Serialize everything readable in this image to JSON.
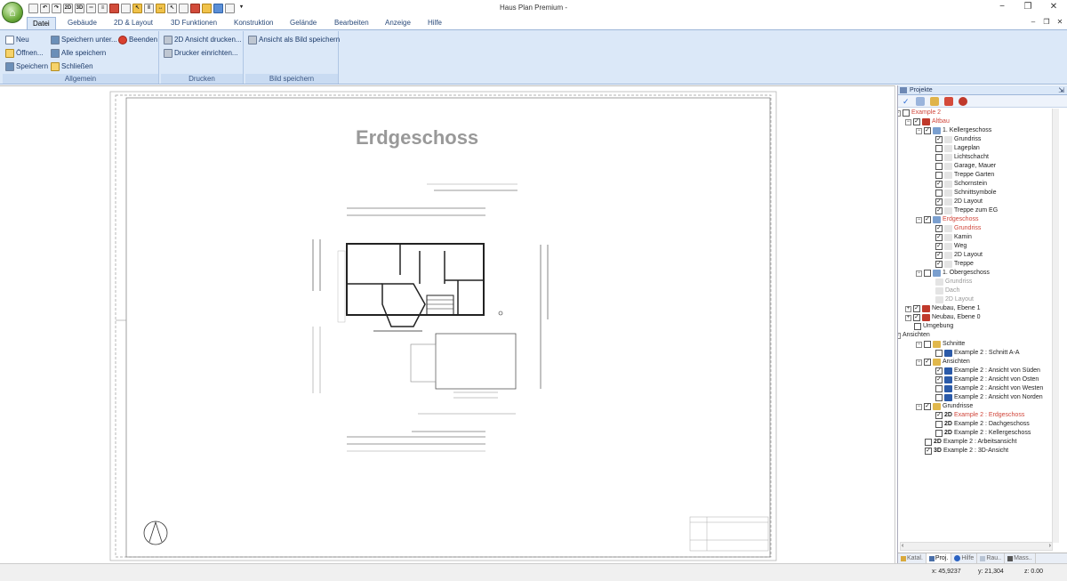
{
  "window": {
    "title": "Haus Plan Premium -",
    "min": "−",
    "max": "❐",
    "close": "✕"
  },
  "ribbon_tabs": [
    "Datei",
    "Gebäude",
    "2D & Layout",
    "3D Funktionen",
    "Konstruktion",
    "Gelände",
    "Bearbeiten",
    "Anzeige",
    "Hilfe"
  ],
  "groups": {
    "allgemein": {
      "label": "Allgemein",
      "neu": "Neu",
      "oeffnen": "Öffnen...",
      "speichern": "Speichern",
      "speichern_unter": "Speichern unter...",
      "alle_speichern": "Alle speichern",
      "schliessen": "Schließen",
      "beenden": "Beenden"
    },
    "drucken": {
      "label": "Drucken",
      "ansicht_drucken": "2D Ansicht drucken...",
      "drucker": "Drucker einrichten..."
    },
    "bild": {
      "label": "Bild speichern",
      "ansicht_bild": "Ansicht als Bild speichern"
    }
  },
  "drawing": {
    "title": "Erdgeschoss"
  },
  "panel": {
    "title": "Projekte",
    "tree": [
      {
        "label": "Example 2",
        "red": true
      },
      {
        "label": "Altbau",
        "red": true
      },
      {
        "label": "1. Kellergeschoss"
      },
      {
        "label": "Grundriss"
      },
      {
        "label": "Lageplan"
      },
      {
        "label": "Lichtschacht"
      },
      {
        "label": "Garage, Mauer"
      },
      {
        "label": "Treppe Garten"
      },
      {
        "label": "Schornstein"
      },
      {
        "label": "Schnittsymbole"
      },
      {
        "label": "2D Layout"
      },
      {
        "label": "Treppe zum EG"
      },
      {
        "label": "Erdgeschoss",
        "red": true
      },
      {
        "label": "Grundriss",
        "red": true
      },
      {
        "label": "Kamin"
      },
      {
        "label": "Weg"
      },
      {
        "label": "2D Layout"
      },
      {
        "label": "Treppe"
      },
      {
        "label": "1. Obergeschoss"
      },
      {
        "label": "Grundriss",
        "gray": true
      },
      {
        "label": "Dach",
        "gray": true
      },
      {
        "label": "2D Layout",
        "gray": true
      },
      {
        "label": "Neubau, Ebene 1"
      },
      {
        "label": "Neubau, Ebene 0"
      },
      {
        "label": "Umgebung"
      },
      {
        "label": "Ansichten"
      },
      {
        "label": "Schnitte"
      },
      {
        "label": "Example 2 : Schnitt A-A"
      },
      {
        "label": "Ansichten"
      },
      {
        "label": "Example 2 : Ansicht von Süden"
      },
      {
        "label": "Example 2 : Ansicht von Osten"
      },
      {
        "label": "Example 2 : Ansicht von Westen"
      },
      {
        "label": "Example 2 : Ansicht von Norden"
      },
      {
        "label": "Grundrisse"
      },
      {
        "label": "Example 2 : Erdgeschoss",
        "red": true,
        "prefix": "2D"
      },
      {
        "label": "Example 2 : Dachgeschoss",
        "prefix": "2D"
      },
      {
        "label": "Example 2 : Kellergeschoss",
        "prefix": "2D"
      },
      {
        "label": "Example 2 : Arbeitsansicht",
        "prefix": "2D"
      },
      {
        "label": "Example 2 : 3D-Ansicht",
        "prefix": "3D"
      }
    ],
    "tabs": [
      "Katal.",
      "Proj.",
      "Hilfe",
      "Rau..",
      "Mass.."
    ]
  },
  "status": {
    "x": "x: 45,9237",
    "y": "y: 21,304",
    "z": "z: 0.00"
  }
}
